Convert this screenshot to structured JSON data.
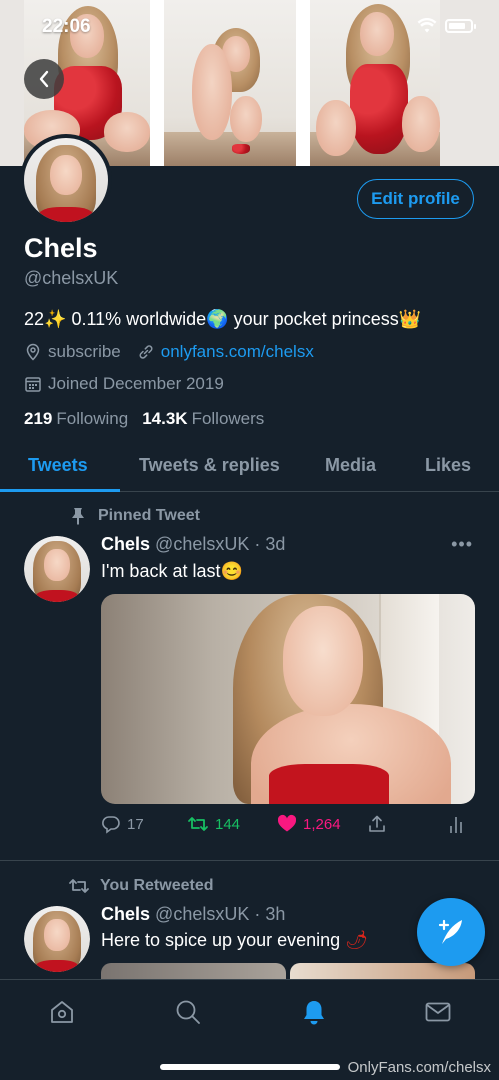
{
  "status_bar": {
    "time": "22:06"
  },
  "profile": {
    "name": "Chels",
    "handle": "@chelsxUK",
    "edit_label": "Edit profile",
    "bio_prefix": "22",
    "bio_middle": " 0.11% worldwide",
    "bio_suffix": " your pocket princess",
    "location": "subscribe",
    "link": "onlyfans.com/chelsx",
    "joined": "Joined December 2019",
    "following_count": "219",
    "following_label": "Following",
    "followers_count": "14.3K",
    "followers_label": "Followers"
  },
  "tabs": [
    {
      "label": "Tweets"
    },
    {
      "label": "Tweets & replies"
    },
    {
      "label": "Media"
    },
    {
      "label": "Likes"
    }
  ],
  "tweets": [
    {
      "context": "Pinned Tweet",
      "name": "Chels",
      "handle": "@chelsxUK",
      "time": "3d",
      "text": "I'm back at last",
      "replies": "17",
      "retweets": "144",
      "likes": "1,264"
    },
    {
      "context": "You Retweeted",
      "name": "Chels",
      "handle": "@chelsxUK",
      "time": "3h",
      "text": "Here to spice up your evening"
    }
  ],
  "watermark": "OnlyFans.com/chelsx",
  "colors": {
    "accent": "#1d9bf0",
    "background": "#15202b",
    "retweet": "#17bf63",
    "like": "#f91880"
  },
  "icons": [
    "back-arrow-icon",
    "wifi-icon",
    "battery-icon",
    "location-icon",
    "link-icon",
    "calendar-icon",
    "pin-icon",
    "retweet-icon",
    "reply-icon",
    "like-icon",
    "share-icon",
    "stats-icon",
    "more-icon",
    "compose-icon",
    "home-icon",
    "search-icon",
    "notifications-icon",
    "messages-icon"
  ]
}
